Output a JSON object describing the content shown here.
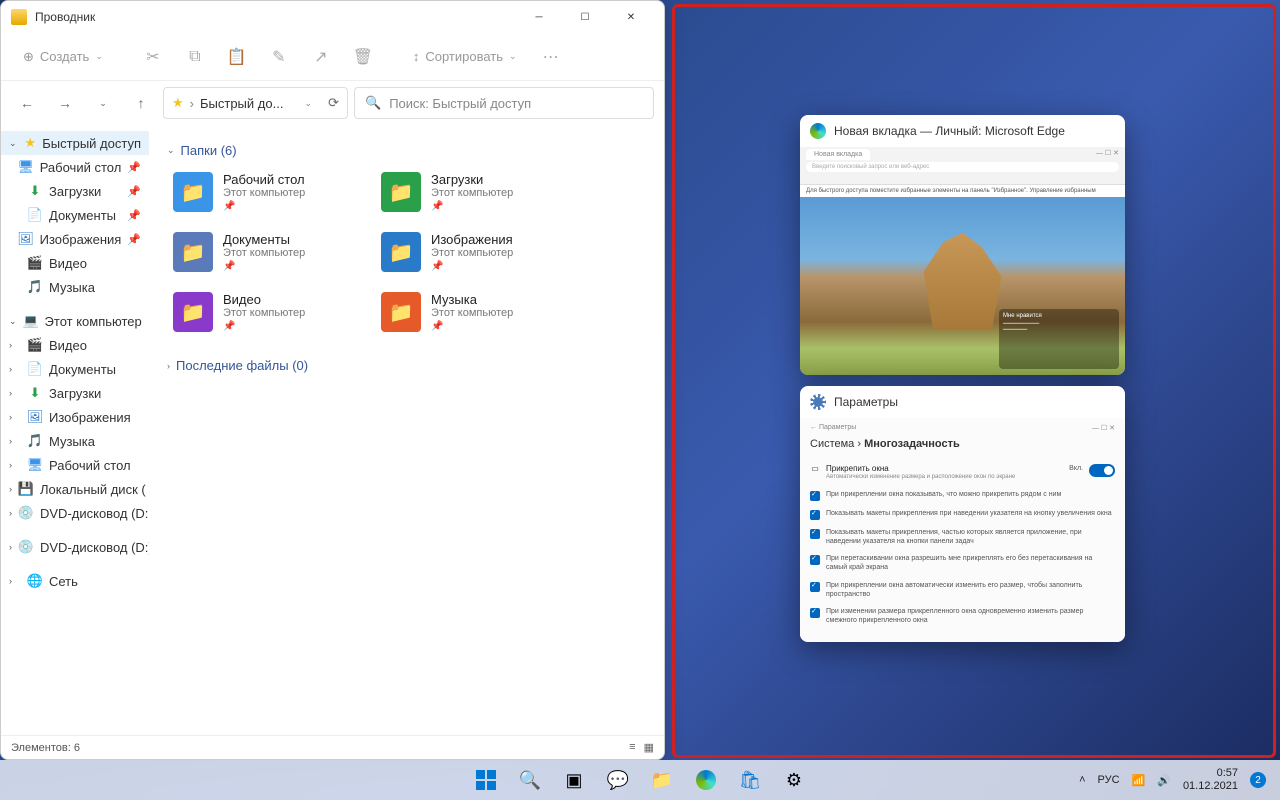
{
  "explorer": {
    "title": "Проводник",
    "new_btn": "Создать",
    "sort_btn": "Сортировать",
    "address_text": "Быстрый до...",
    "search_placeholder": "Поиск: Быстрый доступ",
    "section_folders": "Папки (6)",
    "section_recent": "Последние файлы (0)",
    "status": "Элементов: 6",
    "sidebar": {
      "quick": "Быстрый доступ",
      "desktop": "Рабочий стол",
      "downloads": "Загрузки",
      "documents": "Документы",
      "pictures": "Изображения",
      "videos": "Видео",
      "music": "Музыка",
      "thispc": "Этот компьютер",
      "videos2": "Видео",
      "documents2": "Документы",
      "downloads2": "Загрузки",
      "pictures2": "Изображения",
      "music2": "Музыка",
      "desktop2": "Рабочий стол",
      "localdisk": "Локальный диск (",
      "dvd1": "DVD-дисковод (D:",
      "dvd2": "DVD-дисковод (D:)",
      "network": "Сеть"
    },
    "folders": [
      {
        "name": "Рабочий стол",
        "sub": "Этот компьютер",
        "color": "ic-desktop"
      },
      {
        "name": "Загрузки",
        "sub": "Этот компьютер",
        "color": "ic-down"
      },
      {
        "name": "Документы",
        "sub": "Этот компьютер",
        "color": "ic-docs"
      },
      {
        "name": "Изображения",
        "sub": "Этот компьютер",
        "color": "ic-pics"
      },
      {
        "name": "Видео",
        "sub": "Этот компьютер",
        "color": "ic-video"
      },
      {
        "name": "Музыка",
        "sub": "Этот компьютер",
        "color": "ic-music"
      }
    ]
  },
  "thumb_edge": {
    "title": "Новая вкладка — Личный: Microsoft Edge",
    "tab": "Новая вкладка",
    "addr_hint": "Введите поисковый запрос или веб-адрес",
    "msg": "Для быстрого доступа поместите избранные элементы на панель \"Избранное\". Управление избранным",
    "overlay_title": "Мне нравится",
    "overlay_line": "—————"
  },
  "thumb_settings": {
    "title": "Параметры",
    "chrome_left": "←   Параметры",
    "chrome_right": "—  ☐  ✕",
    "bc_system": "Система",
    "bc_sep": " › ",
    "bc_page": "Многозадачность",
    "snap_title": "Прикрепить окна",
    "snap_sub": "Автоматически изменение размера и расположение окон по экране",
    "toggle_label": "Вкл.",
    "opts": [
      "При прикреплении окна показывать, что можно прикрепить рядом с ним",
      "Показывать макеты прикрепления при наведении указателя на кнопку увеличения окна",
      "Показывать макеты прикрепления, частью которых является приложение, при наведении указателя на кнопки панели задач",
      "При перетаскивании окна разрешить мне прикреплять его без перетаскивания на самый край экрана",
      "При прикреплении окна автоматически изменить его размер, чтобы заполнить пространство",
      "При изменении размера прикрепленного окна одновременно изменить размер смежного прикрепленного окна"
    ]
  },
  "taskbar": {
    "lang": "РУС",
    "time": "0:57",
    "date": "01.12.2021",
    "notif": "2"
  }
}
